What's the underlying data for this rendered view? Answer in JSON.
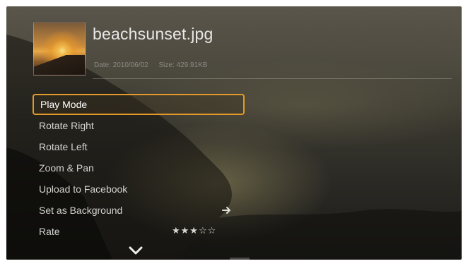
{
  "file": {
    "name": "beachsunset.jpg",
    "date": "Date: 2010/06/02",
    "size": "Size: 429.91KB"
  },
  "menu": {
    "items": [
      {
        "label": "Play Mode",
        "selected": true
      },
      {
        "label": "Rotate Right"
      },
      {
        "label": "Rotate Left"
      },
      {
        "label": "Zoom & Pan"
      },
      {
        "label": "Upload to Facebook"
      },
      {
        "label": "Set as Background",
        "icon": "arrow-right-icon"
      },
      {
        "label": "Rate",
        "rating": 3,
        "rating_max": 5,
        "stars": "★★★☆☆"
      }
    ]
  },
  "colors": {
    "selection_border": "#e39a2a",
    "text": "#d4d4cf"
  },
  "icons": {
    "more_below": "chevron-down-icon",
    "thumbnail": "photo-thumbnail"
  }
}
